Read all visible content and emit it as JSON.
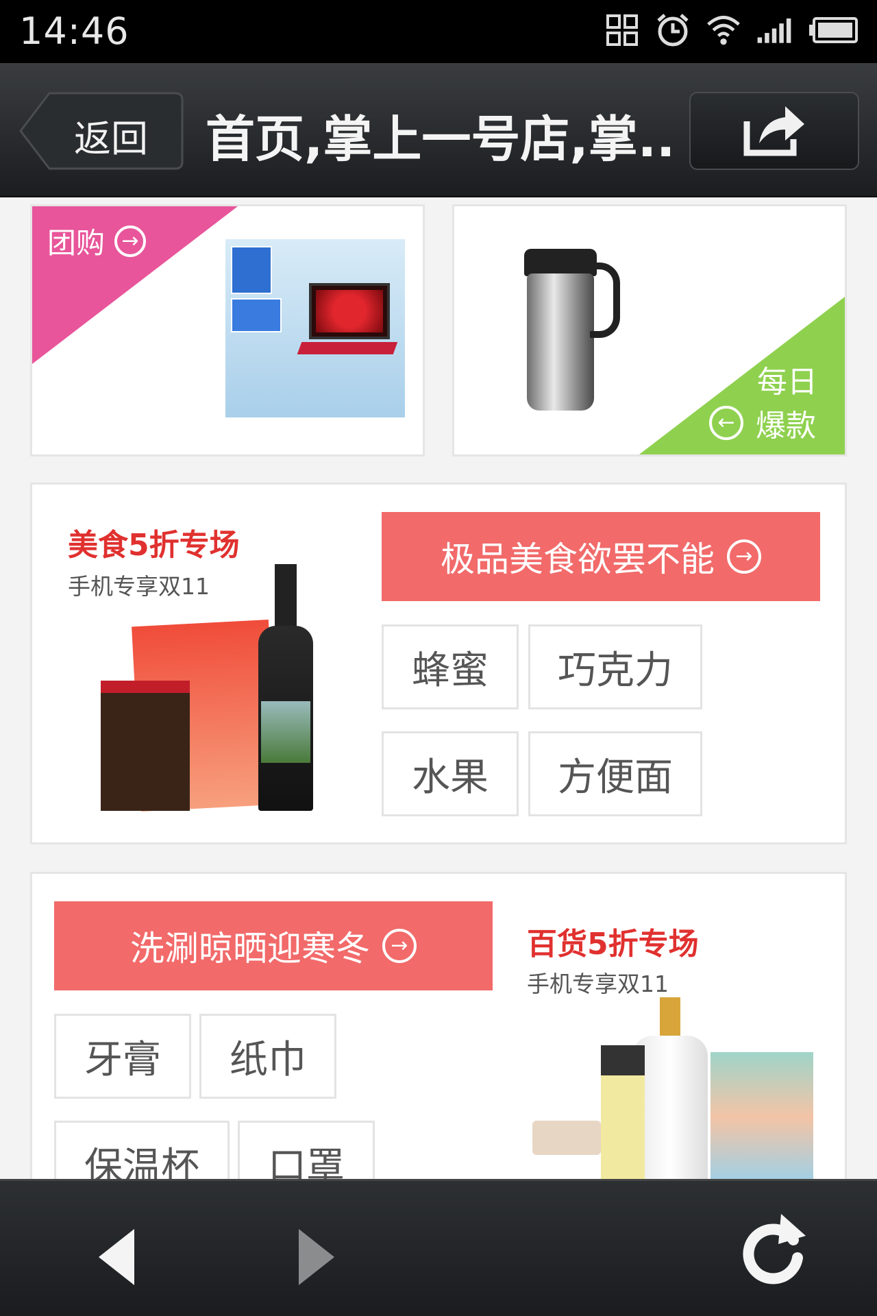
{
  "status_bar": {
    "time": "14:46"
  },
  "nav": {
    "back_label": "返回",
    "title": "首页,掌上一号店,掌.."
  },
  "top_cards": {
    "group_buy_label": "团购",
    "daily_line1": "每日",
    "daily_line2": "爆款"
  },
  "food_section": {
    "title": "美食5折专场",
    "subtitle": "手机专享双11",
    "banner": "极品美食欲罢不能",
    "tags": [
      "蜂蜜",
      "巧克力",
      "水果",
      "方便面"
    ]
  },
  "goods_section": {
    "title": "百货5折专场",
    "subtitle": "手机专享双11",
    "banner": "洗涮晾晒迎寒冬",
    "tags": [
      "牙膏",
      "纸巾",
      "保温杯",
      "口罩"
    ]
  },
  "colors": {
    "accent_red": "#f26a6a",
    "group_pink": "#e8559a",
    "daily_green": "#8fd14f"
  },
  "icons": [
    "grid-icon",
    "alarm-icon",
    "wifi-icon",
    "signal-icon",
    "battery-icon",
    "share-icon",
    "back-arrow-icon",
    "forward-arrow-icon",
    "refresh-icon"
  ]
}
